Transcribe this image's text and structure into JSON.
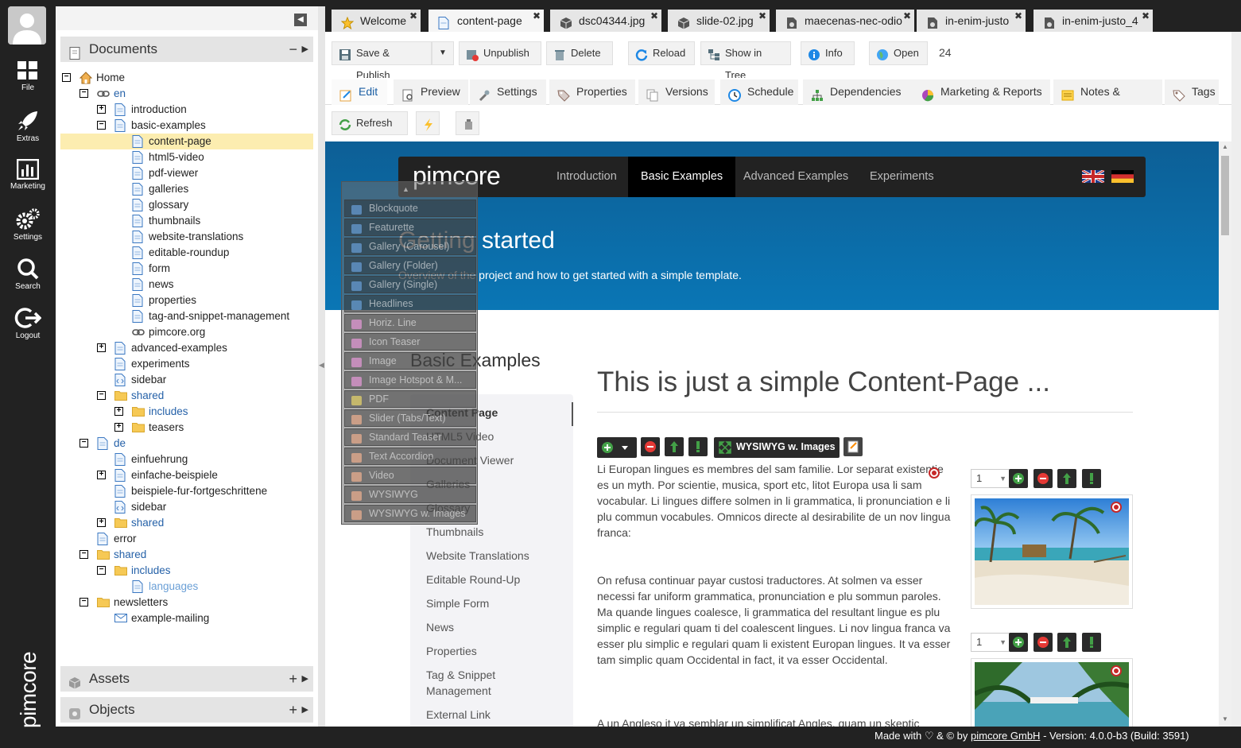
{
  "rail": {
    "items": [
      {
        "label": "File",
        "icon": "file-grid-icon"
      },
      {
        "label": "Extras",
        "icon": "rocket-icon"
      },
      {
        "label": "Marketing",
        "icon": "bar-chart-icon"
      },
      {
        "label": "Settings",
        "icon": "gears-icon"
      },
      {
        "label": "Search",
        "icon": "search-icon"
      },
      {
        "label": "Logout",
        "icon": "logout-icon"
      }
    ],
    "brand": "pimcore"
  },
  "tree": {
    "documents_title": "Documents",
    "assets_title": "Assets",
    "objects_title": "Objects",
    "nodes": [
      {
        "label": "Home"
      },
      {
        "label": "en"
      },
      {
        "label": "introduction"
      },
      {
        "label": "basic-examples"
      },
      {
        "label": "content-page"
      },
      {
        "label": "html5-video"
      },
      {
        "label": "pdf-viewer"
      },
      {
        "label": "galleries"
      },
      {
        "label": "glossary"
      },
      {
        "label": "thumbnails"
      },
      {
        "label": "website-translations"
      },
      {
        "label": "editable-roundup"
      },
      {
        "label": "form"
      },
      {
        "label": "news"
      },
      {
        "label": "properties"
      },
      {
        "label": "tag-and-snippet-management"
      },
      {
        "label": "pimcore.org"
      },
      {
        "label": "advanced-examples"
      },
      {
        "label": "experiments"
      },
      {
        "label": "sidebar"
      },
      {
        "label": "shared"
      },
      {
        "label": "includes"
      },
      {
        "label": "teasers"
      },
      {
        "label": "de"
      },
      {
        "label": "einfuehrung"
      },
      {
        "label": "einfache-beispiele"
      },
      {
        "label": "beispiele-fur-fortgeschrittene"
      },
      {
        "label": "sidebar"
      },
      {
        "label": "shared"
      },
      {
        "label": "error"
      },
      {
        "label": "shared"
      },
      {
        "label": "includes"
      },
      {
        "label": "languages"
      },
      {
        "label": "newsletters"
      },
      {
        "label": "example-mailing"
      }
    ]
  },
  "tabs": [
    {
      "label": "Welcome",
      "icon": "star-icon"
    },
    {
      "label": "content-page",
      "icon": "document-icon"
    },
    {
      "label": "dsc04344.jpg",
      "icon": "cube-icon"
    },
    {
      "label": "slide-02.jpg",
      "icon": "cube-icon"
    },
    {
      "label": "maecenas-nec-odio",
      "icon": "object-icon"
    },
    {
      "label": "in-enim-justo",
      "icon": "object-icon"
    },
    {
      "label": "in-enim-justo_4",
      "icon": "object-icon"
    }
  ],
  "toolbar": {
    "save_publish": "Save & Publish",
    "unpublish": "Unpublish",
    "delete": "Delete",
    "reload": "Reload",
    "show_in_tree": "Show in Tree",
    "info": "Info",
    "open": "Open",
    "id": "24"
  },
  "subtabs": [
    {
      "label": "Edit"
    },
    {
      "label": "Preview"
    },
    {
      "label": "Settings"
    },
    {
      "label": "Properties"
    },
    {
      "label": "Versions"
    },
    {
      "label": "Schedule"
    },
    {
      "label": "Dependencies"
    },
    {
      "label": "Marketing & Reports"
    },
    {
      "label": "Notes & Events"
    },
    {
      "label": "Tags"
    }
  ],
  "subtool": {
    "refresh": "Refresh"
  },
  "site": {
    "logo": "pimcore",
    "nav": [
      "Introduction",
      "Basic Examples",
      "Advanced Examples",
      "Experiments"
    ],
    "hero_title": "Getting started",
    "hero_sub": "Overview of the project and how to get started with a simple template.",
    "sidebar_title": "Basic Examples",
    "sidebar_items": [
      "Content Page",
      "HTML5 Video",
      "Document Viewer",
      "Galleries",
      "Glossary",
      "Thumbnails",
      "Website Translations",
      "Editable Round-Up",
      "Simple Form",
      "News",
      "Properties",
      "Tag & Snippet",
      "Management",
      "External Link"
    ],
    "main_title": "This is just a simple Content-Page ...",
    "editable_label": "WYSIWYG w. Images",
    "select_value": "1",
    "para1": "Li Europan lingues es membres del sam familie. Lor separat existentie es un myth. Por scientie, musica, sport etc, litot Europa usa li sam vocabular. Li lingues differe solmen in li grammatica, li pronunciation e li plu commun vocabules. Omnicos directe al desirabilite de un nov lingua franca:",
    "para2": "On refusa continuar payar custosi traductores. At solmen va esser necessi far uniform grammatica, pronunciation e plu sommun paroles. Ma quande lingues coalesce, li grammatica del resultant lingue es plu simplic e regulari quam ti del coalescent lingues. Li nov lingua franca va esser plu simplic e regulari quam li existent Europan lingues. It va esser tam simplic quam Occidental in fact, it va esser Occidental.",
    "para3": "A un Angleso it va semblar un simplificat Angles, quam un skeptic"
  },
  "popup": [
    "Blockquote",
    "Featurette",
    "Gallery (Carousel)",
    "Gallery (Folder)",
    "Gallery (Single)",
    "Headlines",
    "Horiz. Line",
    "Icon Teaser",
    "Image",
    "Image Hotspot & M...",
    "PDF",
    "Slider (Tabs/Text)",
    "Standard Teaser",
    "Text Accordion",
    "Video",
    "WYSIWYG",
    "WYSIWYG w. Images"
  ],
  "footer": {
    "made_with": "Made with",
    "amp": "&",
    "by": "by",
    "company": "pimcore GmbH",
    "version": "- Version: 4.0.0-b3 (Build: 3591)"
  },
  "colors": {
    "accent": "#1a5ea3",
    "hero": "#0a76b5",
    "selected_row": "#fcedb0",
    "rail": "#222222"
  }
}
